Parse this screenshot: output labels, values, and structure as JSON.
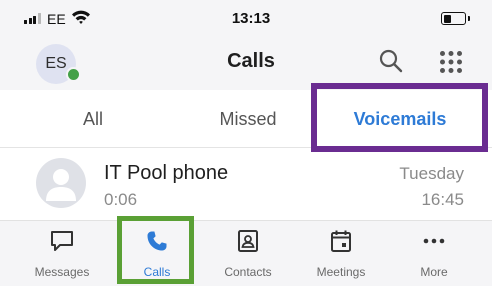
{
  "status_bar": {
    "carrier": "EE",
    "time": "13:13",
    "battery_fraction": 0.4,
    "signal_bars": 3,
    "signal_total": 4
  },
  "header": {
    "avatar_initials": "ES",
    "title": "Calls",
    "presence_color": "#43a047"
  },
  "tabs": {
    "all": "All",
    "missed": "Missed",
    "voicemails": "Voicemails",
    "active": "voicemails"
  },
  "voicemails": [
    {
      "name": "IT Pool phone",
      "duration": "0:06",
      "day": "Tuesday",
      "time": "16:45"
    }
  ],
  "bottom_nav": {
    "messages": "Messages",
    "calls": "Calls",
    "contacts": "Contacts",
    "meetings": "Meetings",
    "more": "More",
    "active": "calls"
  },
  "colors": {
    "accent": "#2e7bd6",
    "highlight_voicemails": "#6a2c91",
    "highlight_calls": "#5aa035"
  },
  "icons": {
    "status": [
      "cell-signal-icon",
      "wifi-icon",
      "battery-icon"
    ],
    "header": [
      "search-icon",
      "dialpad-icon"
    ],
    "nav": [
      "message-icon",
      "phone-icon",
      "contacts-icon",
      "calendar-icon",
      "more-icon"
    ]
  }
}
